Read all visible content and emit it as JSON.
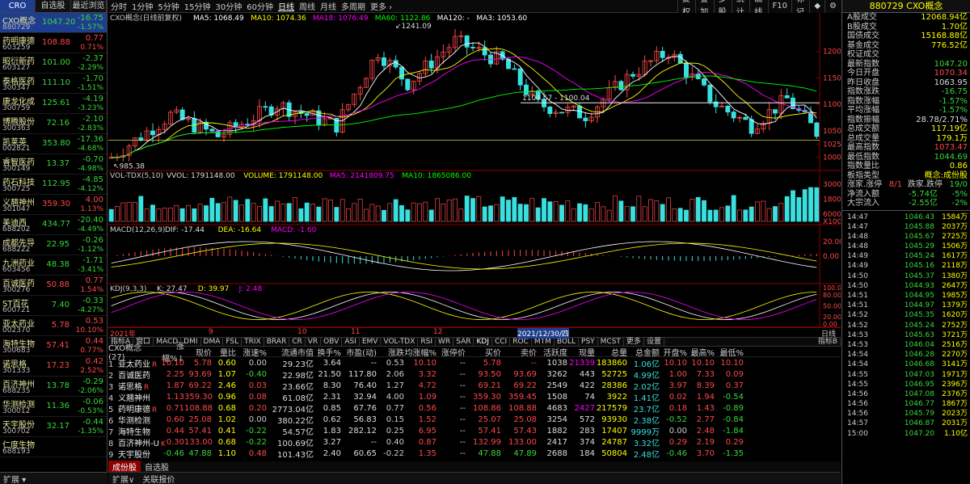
{
  "left": {
    "tabs": [
      "CRO",
      "自选股",
      "最近浏览"
    ],
    "rows": [
      {
        "name": "CXO概念",
        "code": "880729",
        "price": "1047.20",
        "chg": "-16.75",
        "pct": "-1.57%",
        "dir": "dn",
        "sel": true
      },
      {
        "name": "药明康德",
        "code": "603259",
        "price": "108.88",
        "chg": "0.77",
        "pct": "0.71%",
        "dir": "up"
      },
      {
        "name": "昭衍新药",
        "code": "603127",
        "price": "101.00",
        "chg": "-2.37",
        "pct": "-2.29%",
        "dir": "dn"
      },
      {
        "name": "泰格医药",
        "code": "300347",
        "price": "111.10",
        "chg": "-1.70",
        "pct": "-1.51%",
        "dir": "dn"
      },
      {
        "name": "康龙化成",
        "code": "300759",
        "price": "125.61",
        "chg": "-4.19",
        "pct": "-3.23%",
        "dir": "dn"
      },
      {
        "name": "博腾股份",
        "code": "300363",
        "price": "72.16",
        "chg": "-2.10",
        "pct": "-2.83%",
        "dir": "dn"
      },
      {
        "name": "凯莱英",
        "code": "002821",
        "price": "353.80",
        "chg": "-17.36",
        "pct": "-4.68%",
        "dir": "dn"
      },
      {
        "name": "睿智医药",
        "code": "300149",
        "price": "13.37",
        "chg": "-0.70",
        "pct": "-4.98%",
        "dir": "dn"
      },
      {
        "name": "药石科技",
        "code": "300725",
        "price": "112.95",
        "chg": "-4.85",
        "pct": "-4.12%",
        "dir": "dn"
      },
      {
        "name": "义翘神州",
        "code": "301047",
        "price": "359.30",
        "chg": "4.00",
        "pct": "1.13%",
        "dir": "up"
      },
      {
        "name": "美迪西",
        "code": "688202",
        "price": "434.77",
        "chg": "-20.40",
        "pct": "-4.49%",
        "dir": "dn"
      },
      {
        "name": "成都先导",
        "code": "688222",
        "price": "22.95",
        "chg": "-0.26",
        "pct": "-1.12%",
        "dir": "dn"
      },
      {
        "name": "九洲药业",
        "code": "603456",
        "price": "48.38",
        "chg": "-1.71",
        "pct": "-3.41%",
        "dir": "dn"
      },
      {
        "name": "百诚医药",
        "code": "300276",
        "price": "50.88",
        "chg": "0.77",
        "pct": "1.54%",
        "dir": "up"
      },
      {
        "name": "ST百花",
        "code": "600721",
        "price": "7.40",
        "chg": "-0.33",
        "pct": "-4.27%",
        "dir": "dn"
      },
      {
        "name": "亚太药业",
        "code": "002370",
        "price": "5.78",
        "chg": "0.53",
        "pct": "10.10%",
        "dir": "up"
      },
      {
        "name": "海特生物",
        "code": "300683",
        "price": "57.41",
        "chg": "0.44",
        "pct": "0.77%",
        "dir": "up"
      },
      {
        "name": "诺思格",
        "code": "301333",
        "price": "17.23",
        "chg": "0.42",
        "pct": "2.52%",
        "dir": "up"
      },
      {
        "name": "百济神州",
        "code": "688235",
        "price": "13.78",
        "chg": "-0.29",
        "pct": "-2.06%",
        "dir": "dn"
      },
      {
        "name": "华测检测",
        "code": "300012",
        "price": "11.36",
        "chg": "-0.06",
        "pct": "-0.53%",
        "dir": "dn"
      },
      {
        "name": "天宇股份",
        "code": "300702",
        "price": "32.17",
        "chg": "-0.44",
        "pct": "-1.35%",
        "dir": "dn"
      },
      {
        "name": "仁度生物",
        "code": "688193",
        "price": "",
        "chg": "",
        "pct": "",
        "dir": "dn"
      }
    ],
    "footer": "扩展 ▾"
  },
  "toolbar": {
    "periods": [
      "分时",
      "1分钟",
      "5分钟",
      "15分钟",
      "30分钟",
      "60分钟",
      "日线",
      "周线",
      "月线",
      "多周期",
      "更多 ›"
    ],
    "active": "日线",
    "right": [
      "复权",
      "叠加",
      "多股",
      "统计",
      "画线",
      "F10",
      "标记",
      "◆",
      "⚙"
    ]
  },
  "chart": {
    "title": "CXO概念(日线前复权)",
    "ma_labels": [
      {
        "t": "MA5: 1068.49",
        "c": "#ffffff"
      },
      {
        "t": "MA10: 1074.36",
        "c": "#ffff00"
      },
      {
        "t": "MA18: 1076.49",
        "c": "#ff00ff"
      },
      {
        "t": "MA60: 1122.86",
        "c": "#00ff00"
      },
      {
        "t": "MA120: -",
        "c": "#ffffff"
      },
      {
        "t": "MA3: 1053.60",
        "c": "#ffffff"
      }
    ],
    "price_axis": [
      "1200",
      "1150",
      "1100",
      "1050",
      "1025",
      "1000"
    ],
    "hi_label": "1241.09",
    "lo_label": "985.38",
    "line_label": "1104.57 - 1100.04",
    "vol_title": "VOL-TDX(5,10)",
    "vol_labels": [
      "VVOL: 1791148.00",
      "VOLUME: 1791148.00",
      "MA5: 2141809.75",
      "MA10: 1865086.00"
    ],
    "vol_axis": [
      "30000",
      "18000",
      "6000",
      "X100"
    ],
    "macd_title": "MACD(12,26,9)",
    "macd_labels": [
      "DIF: -17.44",
      "DEA: -16.64",
      "MACD: -1.60"
    ],
    "macd_axis": [
      "20.00",
      "0.00"
    ],
    "kdj_title": "KDJ(9,3,3)",
    "kdj_labels": [
      "K: 27.47",
      "D: 39.97",
      "J: 2.48"
    ],
    "kdj_axis": [
      "100.00",
      "80.00",
      "50.00",
      "20.00",
      "0.00"
    ],
    "dates": [
      "2021年",
      "9",
      "10",
      "11",
      "12",
      "2021/12/30/四"
    ],
    "date_right": "日线"
  },
  "bottom_tabs": [
    "指标A",
    "窗口",
    "MACD",
    "DMI",
    "DMA",
    "FSL",
    "TRIX",
    "BRAR",
    "CR",
    "VR",
    "OBV",
    "ASI",
    "EMV",
    "VOL-TDX",
    "RSI",
    "WR",
    "SAR",
    "KDJ",
    "CCI",
    "ROC",
    "MTM",
    "BOLL",
    "PSY",
    "MCST",
    "更多",
    "设置"
  ],
  "bottom_tabs_right": "指标B",
  "table": {
    "headers": [
      "CXO概念(27)",
      "涨幅%↓",
      "现价",
      "量比",
      "涨速%",
      "流通市值",
      "换手%",
      "市盈(动)",
      "涨跌",
      "均涨幅%",
      "涨停价",
      "买价",
      "卖价",
      "活跃度",
      "现量",
      "总量",
      "总金额",
      "开盘%",
      "最高%",
      "最低%"
    ],
    "rows": [
      [
        "1",
        "亚太药业",
        "R",
        "10.10",
        "5.78",
        "0.60",
        "0.00",
        "29.23亿",
        "3.64",
        "--",
        "0.53",
        "10.10",
        "--",
        "5.78",
        "--",
        "1038",
        "21339",
        "183860",
        "1.06亿",
        "10.10",
        "10.10",
        "10.10"
      ],
      [
        "2",
        "百诚医药",
        "",
        "2.25",
        "93.69",
        "1.07",
        "-0.40",
        "22.98亿",
        "21.50",
        "117.80",
        "2.06",
        "3.32",
        "--",
        "93.50",
        "93.69",
        "3262",
        "443",
        "52725",
        "4.99亿",
        "1.00",
        "7.33",
        "0.09"
      ],
      [
        "3",
        "诺思格",
        "R",
        "1.87",
        "69.22",
        "2.46",
        "0.03",
        "23.66亿",
        "8.30",
        "76.40",
        "1.27",
        "4.72",
        "--",
        "69.21",
        "69.22",
        "2549",
        "422",
        "28386",
        "2.02亿",
        "3.97",
        "8.39",
        "0.37"
      ],
      [
        "4",
        "义翘神州",
        "",
        "1.13",
        "359.30",
        "0.96",
        "0.08",
        "61.08亿",
        "2.31",
        "32.94",
        "4.00",
        "1.09",
        "--",
        "359.30",
        "359.45",
        "1508",
        "74",
        "3922",
        "1.41亿",
        "0.02",
        "1.94",
        "-0.54"
      ],
      [
        "5",
        "药明康德",
        "R",
        "0.71",
        "108.88",
        "0.68",
        "0.20",
        "2773.04亿",
        "0.85",
        "67.76",
        "0.77",
        "0.56",
        "--",
        "108.86",
        "108.88",
        "4683",
        "2427",
        "217579",
        "23.7亿",
        "0.18",
        "1.43",
        "-0.89"
      ],
      [
        "6",
        "华测检测",
        "",
        "0.60",
        "25.08",
        "1.02",
        "0.00",
        "380.22亿",
        "0.62",
        "56.83",
        "0.15",
        "1.52",
        "--",
        "25.07",
        "25.08",
        "3254",
        "572",
        "93930",
        "2.38亿",
        "-0.52",
        "2.77",
        "-0.84"
      ],
      [
        "7",
        "海特生物",
        "",
        "0.44",
        "57.41",
        "0.41",
        "-0.22",
        "54.57亿",
        "1.83",
        "282.12",
        "0.25",
        "6.95",
        "--",
        "57.41",
        "57.43",
        "1882",
        "283",
        "17407",
        "9999万",
        "0.00",
        "2.48",
        "-1.84"
      ],
      [
        "8",
        "百济神州-U",
        "K",
        "0.30",
        "133.00",
        "0.68",
        "-0.22",
        "100.69亿",
        "3.27",
        "--",
        "0.40",
        "0.87",
        "--",
        "132.99",
        "133.00",
        "2417",
        "374",
        "24787",
        "3.32亿",
        "0.29",
        "2.19",
        "0.29"
      ],
      [
        "9",
        "天宇股份",
        "",
        "-0.46",
        "47.88",
        "1.10",
        "0.48",
        "101.43亿",
        "2.40",
        "60.65",
        "-0.22",
        "1.35",
        "--",
        "47.88",
        "47.89",
        "2688",
        "184",
        "50804",
        "2.48亿",
        "-0.46",
        "3.70",
        "-1.35"
      ]
    ]
  },
  "sheet_tabs": [
    "成份股",
    "自选股"
  ],
  "footer_tabs": [
    "扩展∨",
    "关联报价"
  ],
  "right": {
    "title": "880729 CXO概念",
    "stats": [
      {
        "k": "A股成交",
        "v": "12068.94亿",
        "c": "#ffff00"
      },
      {
        "k": "B股成交",
        "v": "1.70亿",
        "c": "#ffff00"
      },
      {
        "k": "国债成交",
        "v": "15168.88亿",
        "c": "#ffff00"
      },
      {
        "k": "基金成交",
        "v": "776.52亿",
        "c": "#ffff00"
      },
      {
        "k": "权证成交",
        "v": "",
        "c": "#ffff00"
      },
      {
        "k": "最新指数",
        "v": "1047.20",
        "c": "#38d838"
      },
      {
        "k": "今日开盘",
        "v": "1070.34",
        "c": "#ff4848"
      },
      {
        "k": "昨日收盘",
        "v": "1063.95",
        "c": "#dddddd"
      },
      {
        "k": "指数涨跌",
        "v": "-16.75",
        "c": "#38d838"
      },
      {
        "k": "指数涨幅",
        "v": "-1.57%",
        "c": "#38d838"
      },
      {
        "k": "平均涨幅",
        "v": "-1.57%",
        "c": "#38d838"
      },
      {
        "k": "指数振幅",
        "v": "28.78/2.71%",
        "c": "#dddddd"
      },
      {
        "k": "总成交额",
        "v": "117.19亿",
        "c": "#ffff00"
      },
      {
        "k": "总成交量",
        "v": "179.1万",
        "c": "#ffff00"
      },
      {
        "k": "最高指数",
        "v": "1073.47",
        "c": "#ff4848"
      },
      {
        "k": "最低指数",
        "v": "1044.69",
        "c": "#38d838"
      },
      {
        "k": "指数量比",
        "v": "0.86",
        "c": "#ffff00"
      }
    ],
    "sector_k": "板指类型",
    "sector_v": "概念:成份股",
    "rise_k": "涨家.涨停",
    "rise_v": "8/1",
    "fall_k": "跌家.跌停",
    "fall_v": "19/0",
    "net_k": "净流入额",
    "net_v": "-5.74亿",
    "net_p": "-5%",
    "big_k": "大宗流入",
    "big_v": "-2.55亿",
    "big_p": "-2%",
    "ticks": [
      [
        "14:47",
        "1046.43",
        "1584万"
      ],
      [
        "14:47",
        "1045.88",
        "2037万"
      ],
      [
        "14:48",
        "1045.67",
        "2725万"
      ],
      [
        "14:48",
        "1045.29",
        "1506万"
      ],
      [
        "14:49",
        "1045.24",
        "1617万"
      ],
      [
        "14:49",
        "1045.16",
        "2118万"
      ],
      [
        "14:50",
        "1045.37",
        "1380万"
      ],
      [
        "14:50",
        "1044.93",
        "2647万"
      ],
      [
        "14:51",
        "1044.95",
        "1985万"
      ],
      [
        "14:51",
        "1044.97",
        "1379万"
      ],
      [
        "14:52",
        "1045.35",
        "1620万"
      ],
      [
        "14:52",
        "1045.24",
        "2752万"
      ],
      [
        "14:53",
        "1045.63",
        "3721万"
      ],
      [
        "14:53",
        "1046.04",
        "2516万"
      ],
      [
        "14:54",
        "1046.28",
        "2270万"
      ],
      [
        "14:54",
        "1046.68",
        "3141万"
      ],
      [
        "14:55",
        "1047.03",
        "1971万"
      ],
      [
        "14:55",
        "1046.95",
        "2396万"
      ],
      [
        "14:56",
        "1047.08",
        "2376万"
      ],
      [
        "14:56",
        "1046.77",
        "1867万"
      ],
      [
        "14:56",
        "1045.79",
        "2023万"
      ],
      [
        "14:57",
        "1046.87",
        "2031万"
      ],
      [
        "15:00",
        "1047.20",
        "1.10亿"
      ]
    ]
  }
}
